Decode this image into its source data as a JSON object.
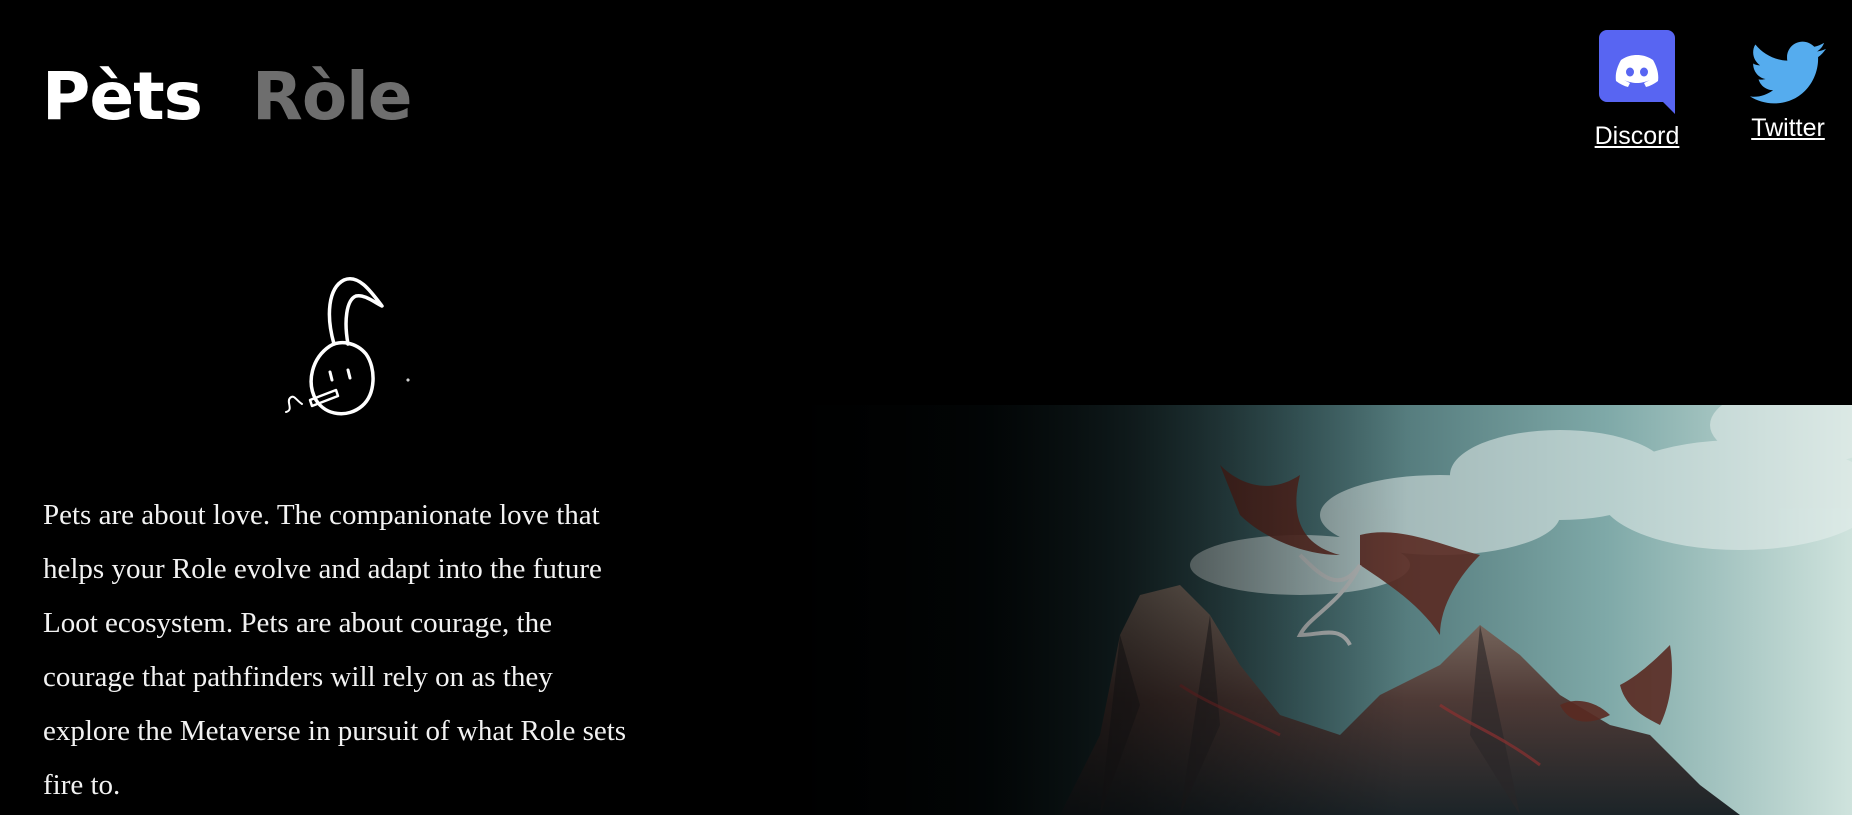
{
  "header": {
    "tabs": [
      {
        "label": "Pèts",
        "active": true
      },
      {
        "label": "Ròle",
        "active": false
      }
    ],
    "social": {
      "discord": {
        "label": "Discord",
        "icon": "discord-icon",
        "color": "#5865F2"
      },
      "twitter": {
        "label": "Twitter",
        "icon": "twitter-icon",
        "color": "#55ACEE"
      }
    }
  },
  "main": {
    "mascot_icon": "bunny-mascot-icon",
    "intro_text": "Pets are about love. The companionate love that helps your Role evolve and adapt into the future Loot ecosystem. Pets are about courage, the courage that pathfinders will rely on as they explore the Metaverse in pursuit of what Role sets fire to.",
    "hero_image": "dragons-over-mountains-illustration"
  },
  "colors": {
    "background": "#000000",
    "text": "#ffffff",
    "inactive_tab": "#6e6e6e"
  }
}
